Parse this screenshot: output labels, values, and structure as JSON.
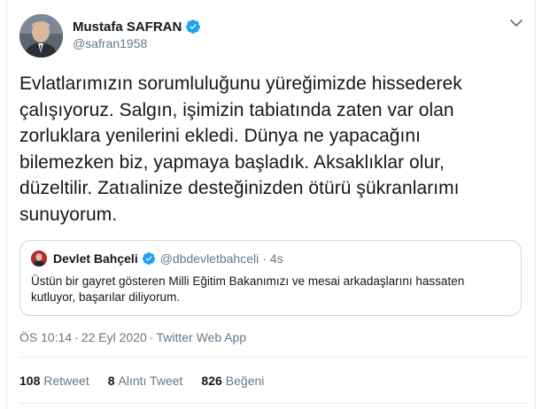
{
  "author": {
    "name": "Mustafa SAFRAN",
    "handle": "@safran1958",
    "verified": true
  },
  "tweet": {
    "lines": [
      "Evlatlarımızın sorumluluğunu yüreğimizde hissederek",
      "çalışıyoruz. Salgın, işimizin tabiatında zaten var olan",
      "zorluklara yenilerini ekledi. Dünya ne yapacağını",
      "bilemezken biz, yapmaya başladık. Aksaklıklar olur,",
      "düzeltilir. Zatıalinize desteğinizden ötürü şükranlarımı",
      "sunuyorum."
    ]
  },
  "quoted": {
    "name": "Devlet Bahçeli",
    "handle": "@dbdevletbahceli",
    "separator": "·",
    "time": "4s",
    "lines": [
      "Üstün bir gayret gösteren Milli Eğitim Bakanımızı ve mesai arkadaşlarını hassaten",
      "kutluyor, başarılar diliyorum."
    ]
  },
  "meta": {
    "time": "ÖS 10:14",
    "separator": "·",
    "date": "22 Eyl 2020",
    "source": "Twitter Web App"
  },
  "stats": {
    "retweets_count": "108",
    "retweets_label": "Retweet",
    "quotes_count": "8",
    "quotes_label": "Alıntı Tweet",
    "likes_count": "826",
    "likes_label": "Beğeni"
  },
  "colors": {
    "verified_badge": "#1da1f2",
    "muted_text": "#657786",
    "primary_text": "#14171a",
    "border": "#ccd6dd"
  },
  "icons": {
    "verified": "verified-badge-icon",
    "caret": "chevron-down-icon"
  }
}
